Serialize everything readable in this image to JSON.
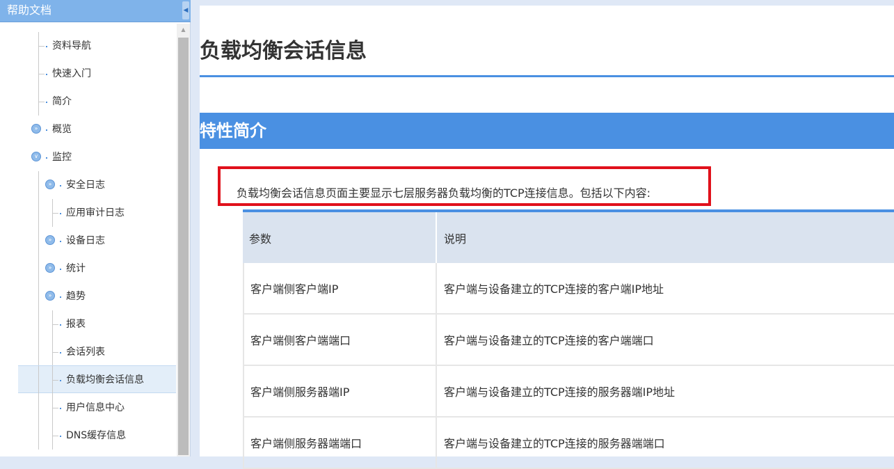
{
  "sidebar": {
    "title": "帮助文档",
    "items": [
      {
        "label": "资料导航"
      },
      {
        "label": "快速入门"
      },
      {
        "label": "简介"
      },
      {
        "label": "概览"
      },
      {
        "label": "监控"
      },
      {
        "label": "安全日志"
      },
      {
        "label": "应用审计日志"
      },
      {
        "label": "设备日志"
      },
      {
        "label": "统计"
      },
      {
        "label": "趋势"
      },
      {
        "label": "报表"
      },
      {
        "label": "会话列表"
      },
      {
        "label": "负载均衡会话信息"
      },
      {
        "label": "用户信息中心"
      },
      {
        "label": "DNS缓存信息"
      }
    ]
  },
  "page": {
    "title": "负载均衡会话信息",
    "section_title": "特性简介",
    "intro": "负载均衡会话信息页面主要显示七层服务器负载均衡的TCP连接信息。包括以下内容:"
  },
  "table": {
    "headers": [
      "参数",
      "说明"
    ],
    "rows": [
      [
        "客户端侧客户端IP",
        "客户端与设备建立的TCP连接的客户端IP地址"
      ],
      [
        "客户端侧客户端端口",
        "客户端与设备建立的TCP连接的客户端端口"
      ],
      [
        "客户端侧服务器端IP",
        "客户端与设备建立的TCP连接的服务器端IP地址"
      ],
      [
        "客户端侧服务器端端口",
        "客户端与设备建立的TCP连接的服务器端端口"
      ]
    ]
  },
  "colors": {
    "accent": "#4a90e2",
    "highlight": "#e0111b",
    "header_bg": "#7fb3ea"
  }
}
